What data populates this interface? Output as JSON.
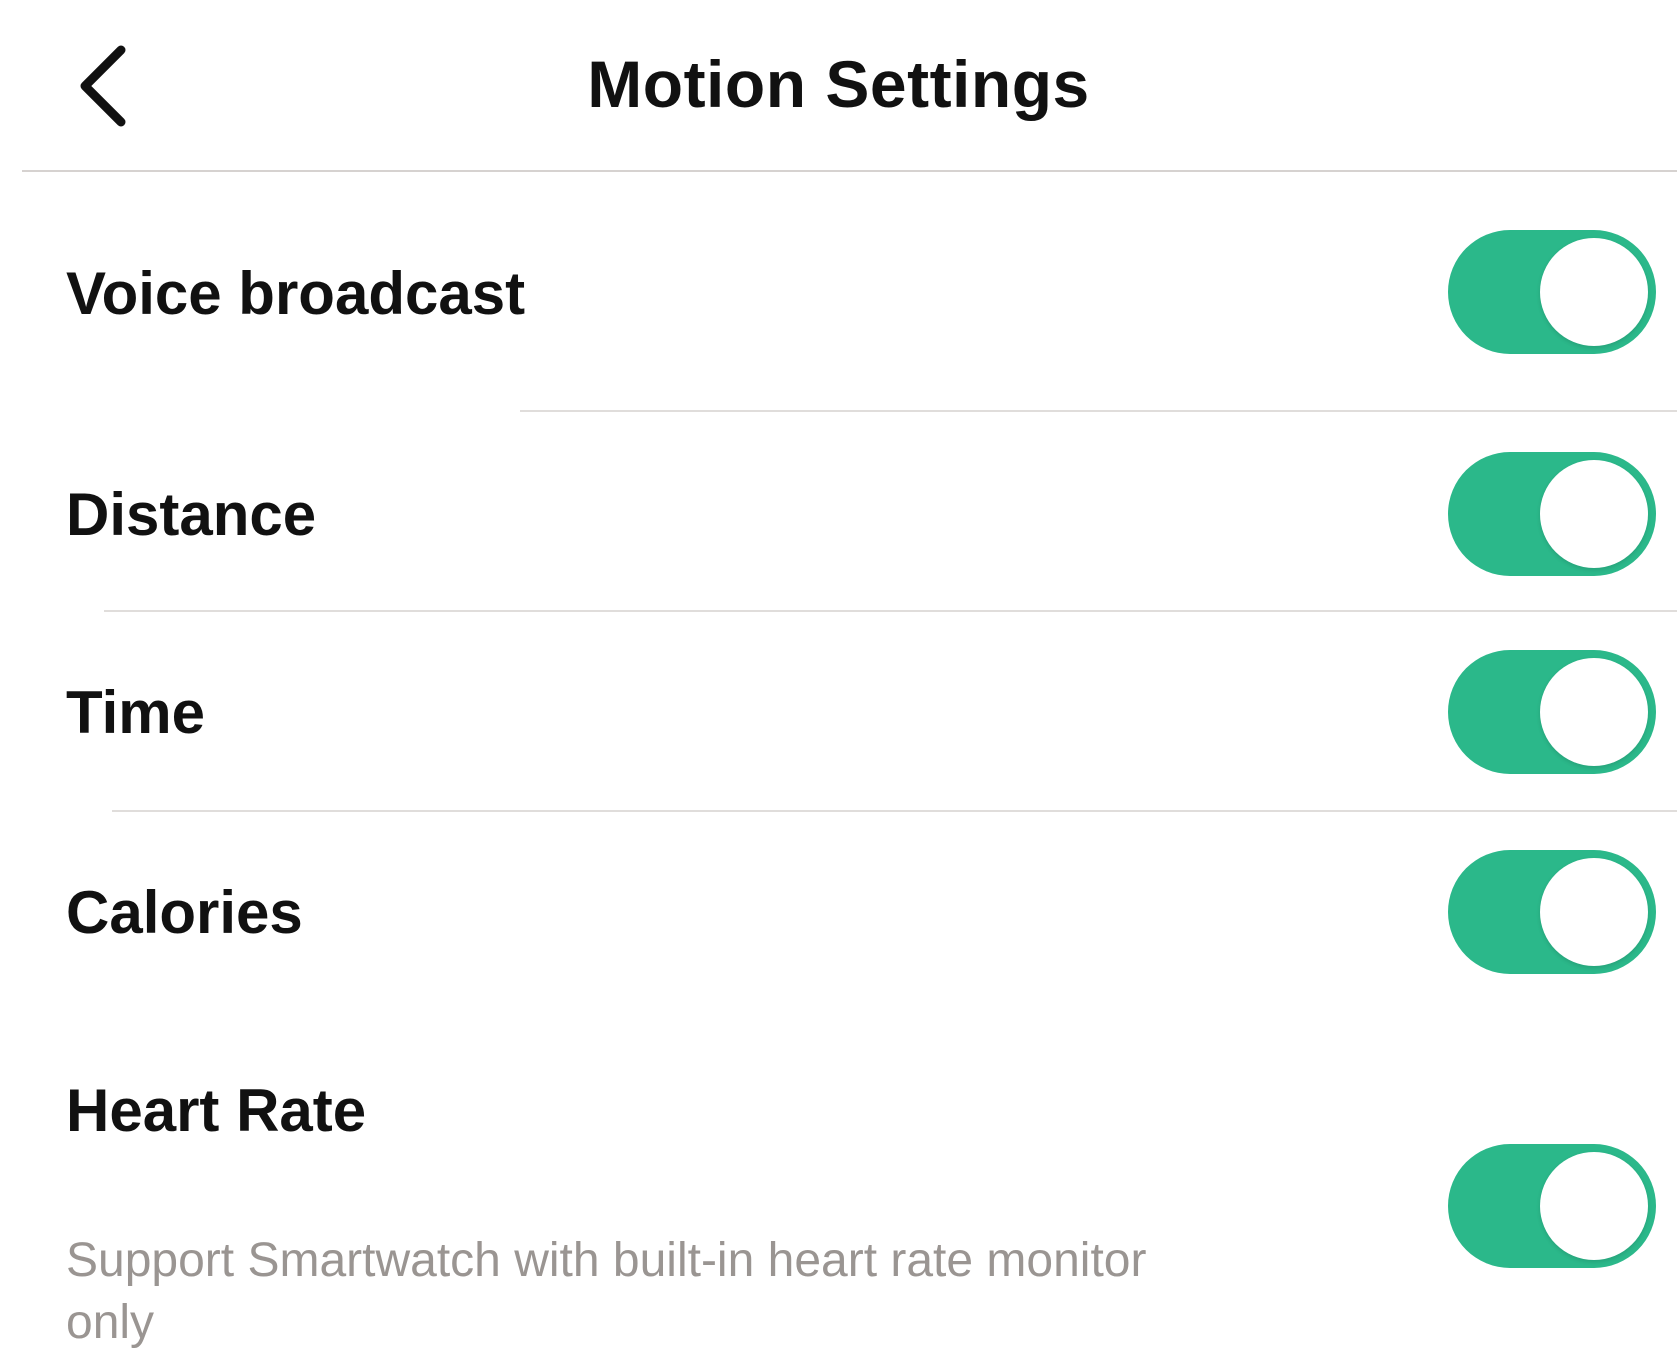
{
  "header": {
    "title": "Motion Settings",
    "back_icon": "chevron-left-icon"
  },
  "colors": {
    "toggle_on": "#2bb88a",
    "subtext": "#9a9592",
    "divider": "#e0dddb"
  },
  "settings": [
    {
      "label": "Voice broadcast",
      "enabled": true
    },
    {
      "label": "Distance",
      "enabled": true
    },
    {
      "label": "Time",
      "enabled": true
    },
    {
      "label": "Calories",
      "enabled": true
    },
    {
      "label": "Heart Rate",
      "description": "Support Smartwatch with built-in heart rate monitor only",
      "enabled": true
    }
  ]
}
